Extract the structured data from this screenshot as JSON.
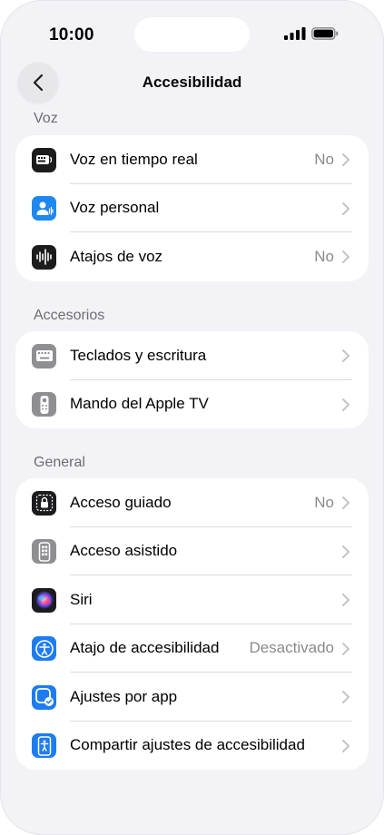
{
  "status_bar": {
    "time": "10:00"
  },
  "navbar": {
    "title": "Accesibilidad"
  },
  "sections": [
    {
      "header": "Voz",
      "items": [
        {
          "label": "Voz en tiempo real",
          "value": "No",
          "icon": "keyboard-speech-icon",
          "icon_bg": "#1c1c1e"
        },
        {
          "label": "Voz personal",
          "value": "",
          "icon": "personal-voice-icon",
          "icon_bg": "#1e88f0"
        },
        {
          "label": "Atajos de voz",
          "value": "No",
          "icon": "waveform-icon",
          "icon_bg": "#1c1c1e"
        }
      ]
    },
    {
      "header": "Accesorios",
      "items": [
        {
          "label": "Teclados y escritura",
          "value": "",
          "icon": "keyboard-icon",
          "icon_bg": "#8e8e93"
        },
        {
          "label": "Mando del Apple TV",
          "value": "",
          "icon": "remote-icon",
          "icon_bg": "#8e8e93"
        }
      ]
    },
    {
      "header": "General",
      "items": [
        {
          "label": "Acceso guiado",
          "value": "No",
          "icon": "guided-access-lock-icon",
          "icon_bg": "#1c1c1e"
        },
        {
          "label": "Acceso asistido",
          "value": "",
          "icon": "assistive-access-icon",
          "icon_bg": "#8e8e93"
        },
        {
          "label": "Siri",
          "value": "",
          "icon": "siri-icon",
          "icon_bg": "#1c1c1e"
        },
        {
          "label": "Atajo de accesibilidad",
          "value": "Desactivado",
          "icon": "accessibility-icon",
          "icon_bg": "#1e7cf2"
        },
        {
          "label": "Ajustes por app",
          "value": "",
          "icon": "per-app-settings-icon",
          "icon_bg": "#1e7cf2"
        },
        {
          "label": "Compartir ajustes de accesibilidad",
          "value": "",
          "icon": "share-accessibility-icon",
          "icon_bg": "#1e7cf2"
        }
      ]
    }
  ],
  "colors": {
    "background": "#f2f2f7",
    "card": "#ffffff",
    "secondary_text": "#8a8a8e",
    "header_text": "#6d6d72"
  }
}
